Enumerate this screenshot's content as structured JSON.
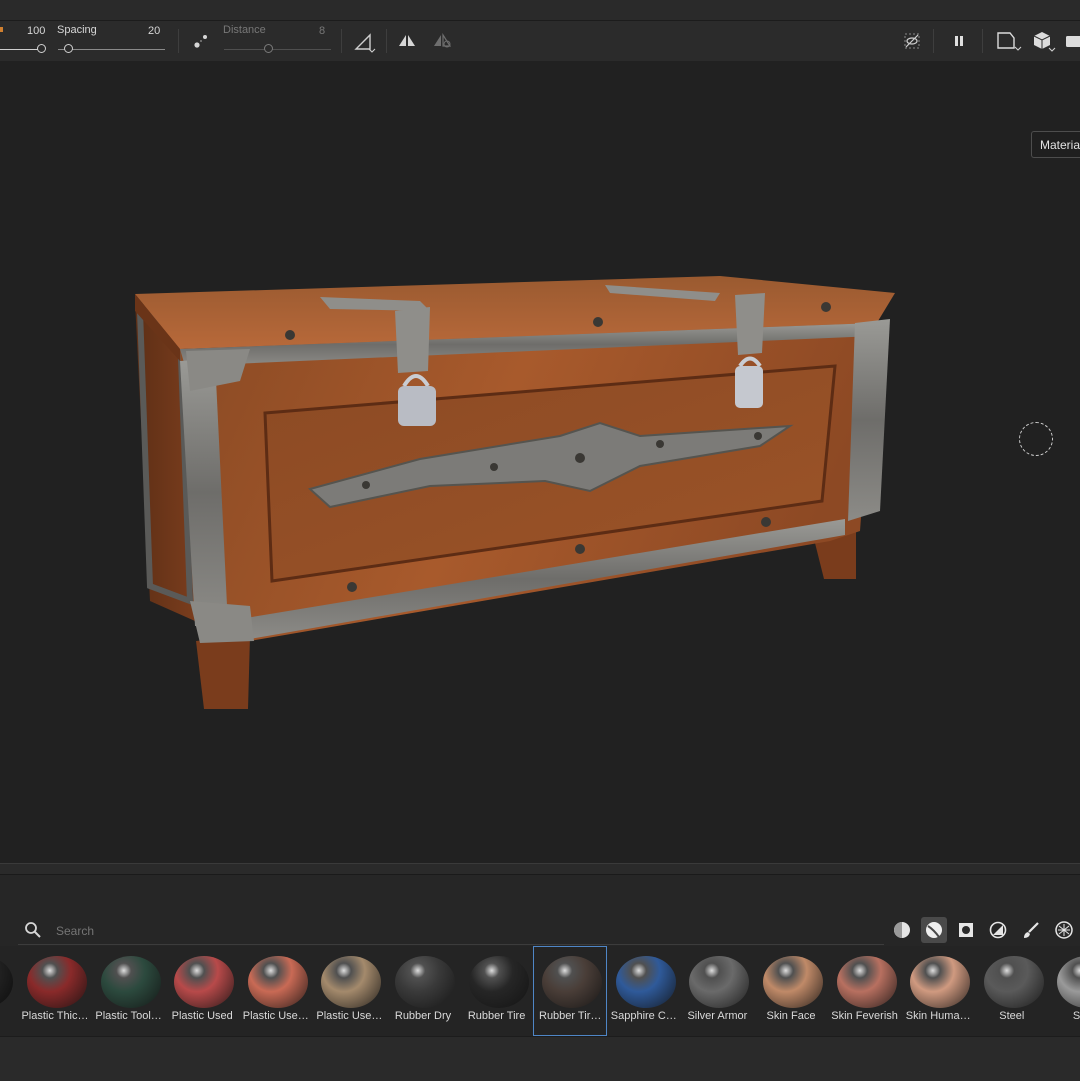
{
  "toolbar": {
    "size_value": "100",
    "spacing_label": "Spacing",
    "spacing_value": "20",
    "distance_label": "Distance",
    "distance_value": "8",
    "icons": [
      "lazy-mouse-icon",
      "line-symmetry-icon",
      "mirror-icon",
      "mirror-off-icon",
      "hide-icon",
      "pause-icon",
      "camera-view-icon",
      "cube-icon",
      "screen-icon"
    ]
  },
  "viewport": {
    "tooltip": "Material",
    "model": "treasure-chest"
  },
  "shelf": {
    "search_placeholder": "Search",
    "filters": [
      "material-filter-icon",
      "smart-material-filter-icon",
      "mask-filter-icon",
      "filter-icon",
      "brush-icon",
      "texture-icon"
    ],
    "active_filter": "smart-material-filter-icon",
    "items": [
      {
        "label": "Plastic Thic…",
        "color": "#8a2a2a"
      },
      {
        "label": "Plastic Tool…",
        "color": "#2c4a3e"
      },
      {
        "label": "Plastic Used",
        "color": "#b84a4a"
      },
      {
        "label": "Plastic Use…",
        "color": "#c96a55"
      },
      {
        "label": "Plastic Use…",
        "color": "#a48a6c"
      },
      {
        "label": "Rubber Dry",
        "color": "#3a3a3a"
      },
      {
        "label": "Rubber Tire",
        "color": "#262626"
      },
      {
        "label": "Rubber Tir…",
        "color": "#4a3e38"
      },
      {
        "label": "Sapphire C…",
        "color": "#2f5a9a"
      },
      {
        "label": "Silver Armor",
        "color": "#6a6a6a"
      },
      {
        "label": "Skin Face",
        "color": "#c08a68"
      },
      {
        "label": "Skin Feverish",
        "color": "#b87060"
      },
      {
        "label": "Skin Huma…",
        "color": "#d09a80"
      },
      {
        "label": "Steel",
        "color": "#5a5a5a"
      },
      {
        "label": "Steel",
        "color": "#9a9a9a"
      }
    ],
    "selected_index": 7
  }
}
